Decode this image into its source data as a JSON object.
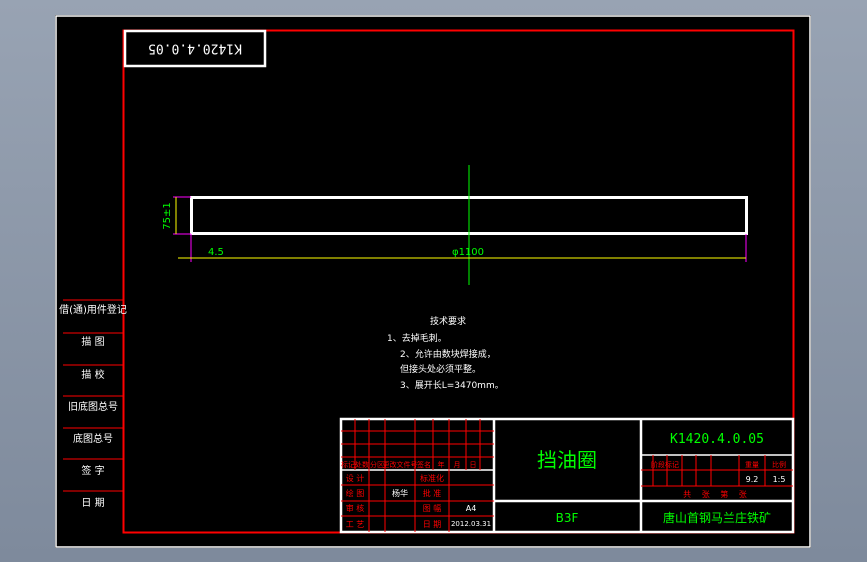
{
  "drawing_code": "K1420.4.0.05",
  "stamp_text": "K1420.4.0.05",
  "part_name": "挡油圈",
  "material": "B3F",
  "company": "唐山首钢马兰庄铁矿",
  "dimensions": {
    "thickness": "75±1",
    "wall": "4.5",
    "diameter": "φ1100"
  },
  "tech_requirements": {
    "title": "技术要求",
    "lines": [
      "1、去掉毛刺。",
      "2、允许由数块焊接成，",
      "但接头处必须平整。",
      "3、展开长L=3470mm。"
    ]
  },
  "side_labels": [
    "借(通)用件登记",
    "描 图",
    "描 校",
    "旧底图总号",
    "底图总号",
    "签 字",
    "日 期"
  ],
  "revision_header": [
    "标记",
    "处数",
    "分区",
    "更改文件号",
    "签名",
    "年",
    "月",
    "日"
  ],
  "signoff": {
    "design": "设 计",
    "draw": "绘 图",
    "drawer_name": "杨华",
    "check": "审 核",
    "process": "工 艺",
    "standard": "标准化",
    "approve": "批 准",
    "sheet_size_label": "图 幅",
    "sheet_size": "A4",
    "date_label": "日 期",
    "date": "2012.03.31"
  },
  "attributes": {
    "stage_label": "阶段标记",
    "weight_label": "重量",
    "scale_label": "比例",
    "weight": "9.2",
    "scale": "1:5",
    "sheets_label": "共 张 第 张"
  },
  "colors": {
    "frame": "#ff0000",
    "outline": "#ffffff",
    "dimension": "#00ff00",
    "text": "#ffffff"
  }
}
